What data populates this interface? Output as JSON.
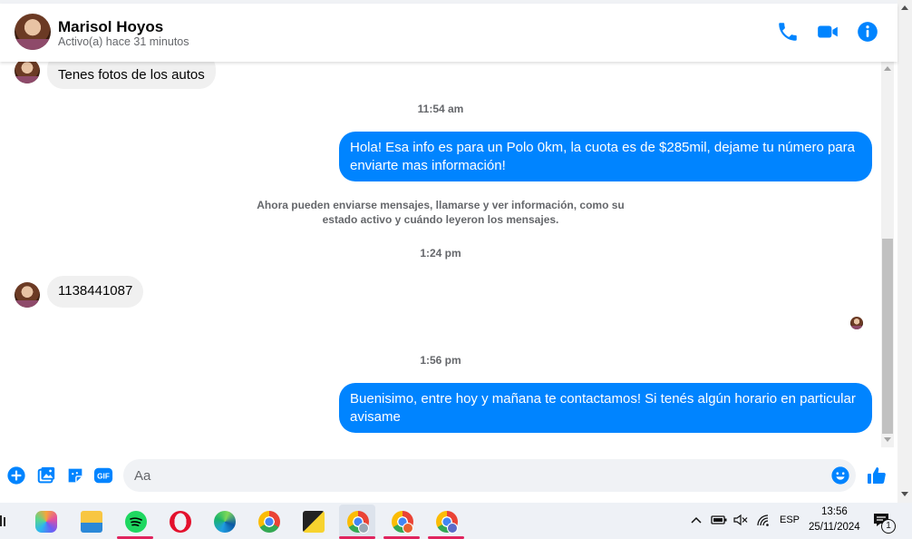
{
  "header": {
    "name": "Marisol Hoyos",
    "status": "Activo(a) hace 31 minutos"
  },
  "messages": {
    "in_1": "Tenes fotos de los autos",
    "time_1": "11:54 am",
    "out_1": "Hola! Esa info es para un Polo 0km, la cuota es de $285mil, dejame tu número para enviarte mas información!",
    "system": "Ahora pueden enviarse mensajes, llamarse y ver información, como su estado activo y cuándo leyeron los mensajes.",
    "time_2": "1:24 pm",
    "in_2": "1138441087",
    "time_3": "1:56 pm",
    "out_2": "Buenisimo, entre hoy y mañana te contactamos! Si tenés algún horario en particular avisame"
  },
  "composer": {
    "placeholder": "Aa"
  },
  "taskbar": {
    "lang": "ESP",
    "time": "13:56",
    "date": "25/11/2024",
    "notif_count": "1"
  },
  "colors": {
    "accent": "#0084ff",
    "incoming_bubble": "#f0f0f0"
  },
  "icons": [
    "phone-icon",
    "video-icon",
    "info-icon",
    "plus-icon",
    "photo-icon",
    "sticker-icon",
    "gif-icon",
    "emoji-icon",
    "like-icon"
  ]
}
